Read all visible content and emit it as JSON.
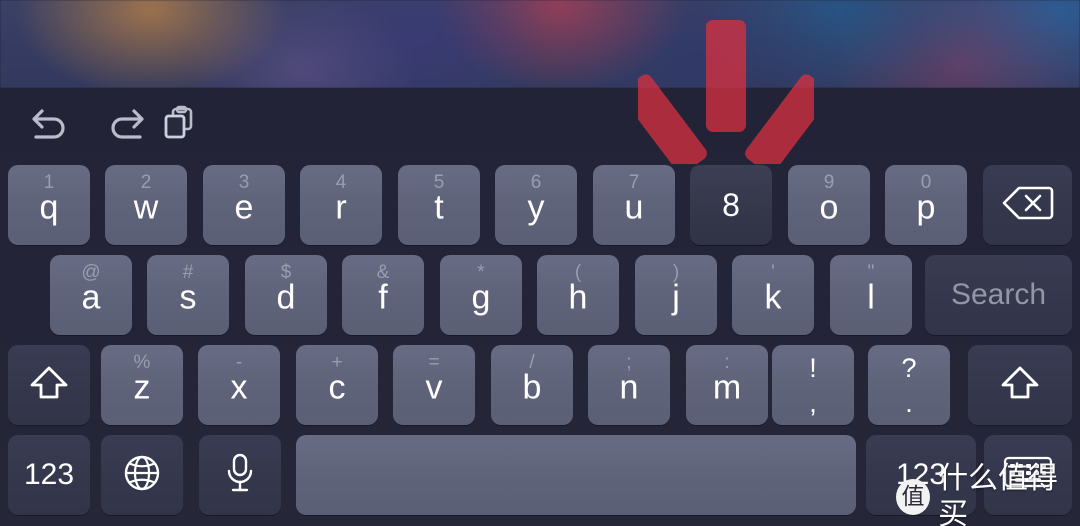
{
  "toolbar": {
    "buttons": [
      {
        "name": "undo-icon",
        "label": "Undo"
      },
      {
        "name": "redo-icon",
        "label": "Redo"
      },
      {
        "name": "paste-icon",
        "label": "Paste"
      }
    ]
  },
  "keyboard": {
    "row1": [
      {
        "sub": "1",
        "main": "q"
      },
      {
        "sub": "2",
        "main": "w"
      },
      {
        "sub": "3",
        "main": "e"
      },
      {
        "sub": "4",
        "main": "r"
      },
      {
        "sub": "5",
        "main": "t"
      },
      {
        "sub": "6",
        "main": "y"
      },
      {
        "sub": "7",
        "main": "u"
      },
      {
        "sub": "8",
        "main": "8"
      },
      {
        "sub": "9",
        "main": "o"
      },
      {
        "sub": "0",
        "main": "p"
      }
    ],
    "row1_pressed_index": 7,
    "backspace": {
      "label": "delete"
    },
    "row2": [
      {
        "sub": "@",
        "main": "a"
      },
      {
        "sub": "#",
        "main": "s"
      },
      {
        "sub": "$",
        "main": "d"
      },
      {
        "sub": "&",
        "main": "f"
      },
      {
        "sub": "*",
        "main": "g"
      },
      {
        "sub": "(",
        "main": "h"
      },
      {
        "sub": ")",
        "main": "j"
      },
      {
        "sub": "'",
        "main": "k"
      },
      {
        "sub": "\"",
        "main": "l"
      }
    ],
    "search_key": {
      "label": "Search"
    },
    "row3": [
      {
        "sub": "%",
        "main": "z"
      },
      {
        "sub": "-",
        "main": "x"
      },
      {
        "sub": "+",
        "main": "c"
      },
      {
        "sub": "=",
        "main": "v"
      },
      {
        "sub": "/",
        "main": "b"
      },
      {
        "sub": ";",
        "main": "n"
      },
      {
        "sub": ":",
        "main": "m"
      }
    ],
    "punct_keys": [
      {
        "top": "!",
        "bottom": ","
      },
      {
        "top": "?",
        "bottom": "."
      }
    ],
    "shift_left": {
      "label": "shift"
    },
    "shift_right": {
      "label": "shift"
    },
    "bottom": {
      "numeric_left": "123",
      "globe": "globe",
      "mic": "microphone",
      "space": "space",
      "numeric_right": "123",
      "dismiss": "hide-keyboard"
    }
  },
  "annotation": {
    "arrow": {
      "direction": "down",
      "color": "#e03040",
      "points_at": "8"
    }
  },
  "watermark": {
    "logo": "值",
    "text": "什么值得买"
  },
  "colors": {
    "key_light": "#61657d",
    "key_dark": "#35384c",
    "keyboard_bg": "#242438",
    "accent_red": "#e03040"
  }
}
